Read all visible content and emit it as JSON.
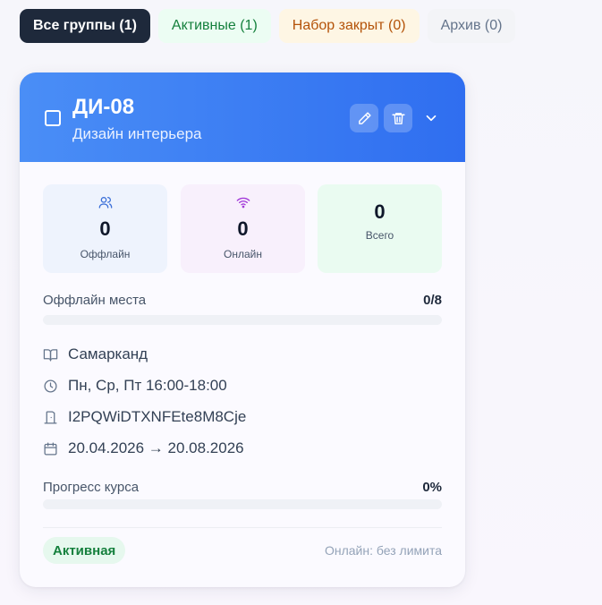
{
  "tabs": [
    {
      "label": "Все группы (1)"
    },
    {
      "label": "Активные (1)"
    },
    {
      "label": "Набор закрыт (0)"
    },
    {
      "label": "Архив (0)"
    }
  ],
  "group": {
    "code": "ДИ-08",
    "name": "Дизайн интерьера",
    "stats": {
      "offline": {
        "value": "0",
        "label": "Оффлайн"
      },
      "online": {
        "value": "0",
        "label": "Онлайн"
      },
      "total": {
        "value": "0",
        "label": "Всего"
      }
    },
    "seats": {
      "label": "Оффлайн места",
      "value": "0/8",
      "fraction": 0
    },
    "location": "Самарканд",
    "schedule": "Пн, Ср, Пт 16:00-18:00",
    "room": "I2PQWiDTXNFEte8M8Cje",
    "dates": "20.04.2026 → 20.08.2026",
    "progress": {
      "label": "Прогресс курса",
      "value": "0%",
      "fraction": 0
    },
    "status": "Активная",
    "online_limit": "Онлайн: без лимита"
  },
  "colors": {
    "header_start": "#4a8ef6",
    "header_end": "#2f6ef0",
    "active_green": "#15803d",
    "closed_orange": "#b45309",
    "dark_tab": "#1e293b"
  },
  "icons": {
    "edit": "pencil-icon",
    "delete": "trash-icon",
    "expand": "chevron-down-icon",
    "offline": "users-icon",
    "online": "wifi-icon",
    "location": "book-icon",
    "schedule": "clock-icon",
    "room": "door-icon",
    "dates": "calendar-icon"
  }
}
